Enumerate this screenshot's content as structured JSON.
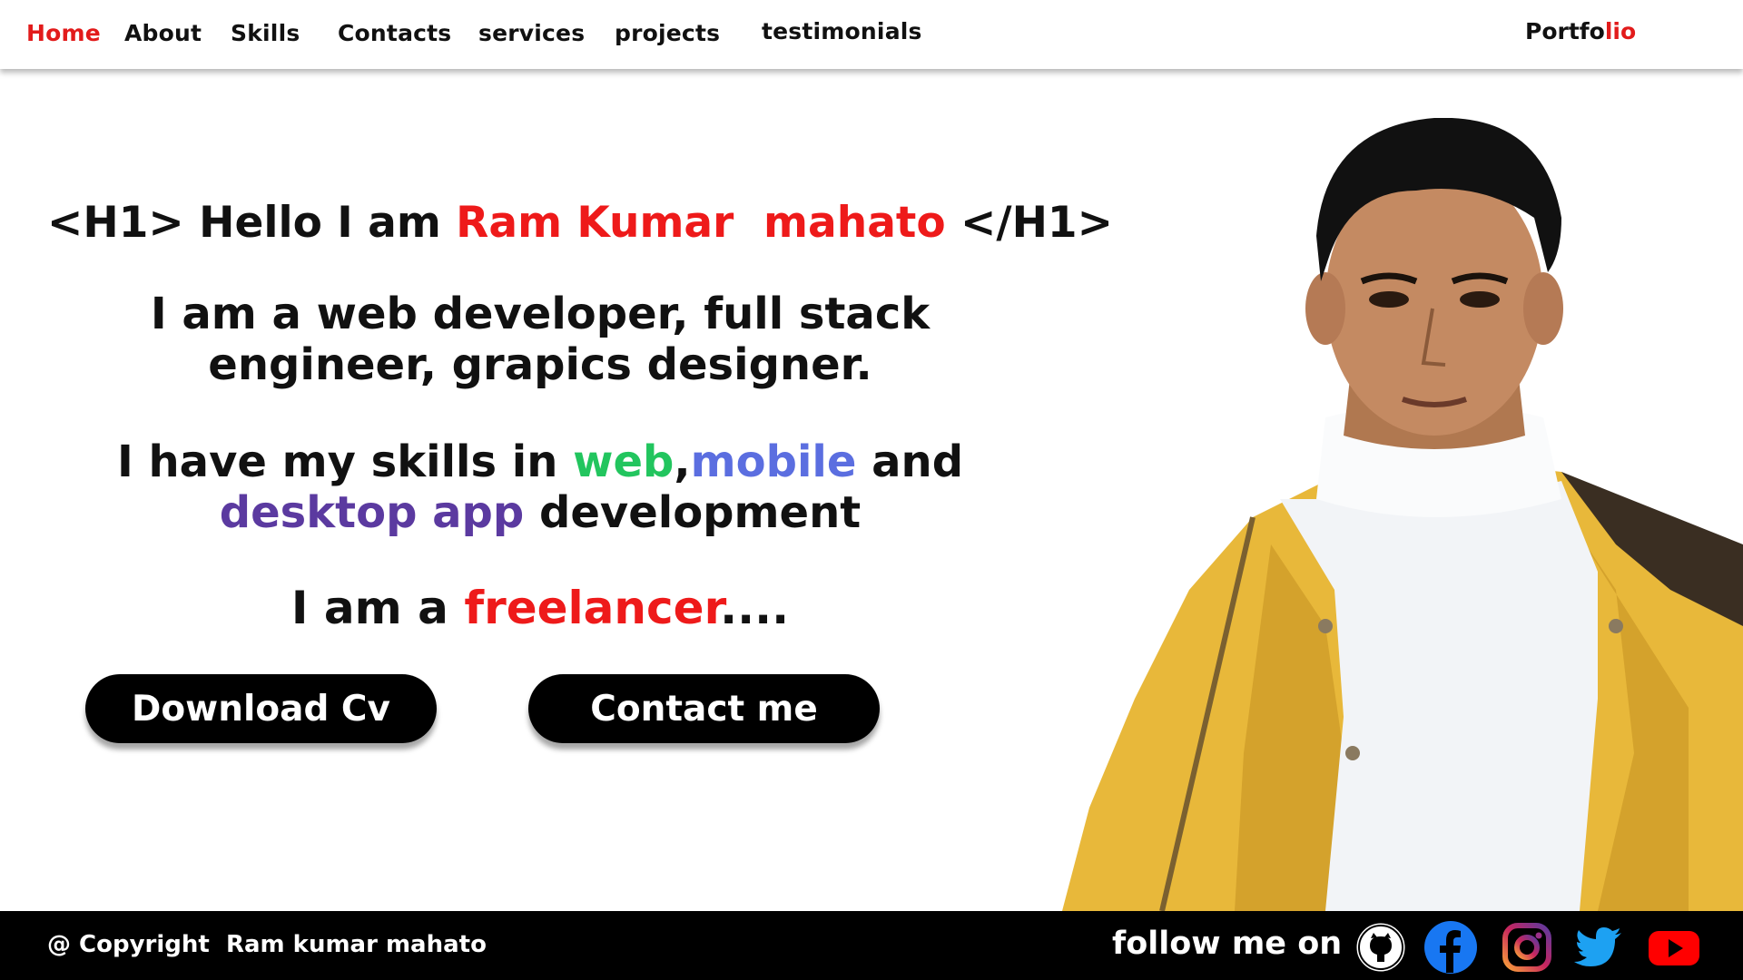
{
  "nav": {
    "items": [
      {
        "label": "Home",
        "active": true
      },
      {
        "label": "About"
      },
      {
        "label": "Skills"
      },
      {
        "label": "Contacts"
      },
      {
        "label": "services"
      },
      {
        "label": "projects"
      },
      {
        "label": "testimonials"
      }
    ],
    "brand_prefix": "Portfo",
    "brand_accent": "lio"
  },
  "hero": {
    "h1_open": "<H1> Hello I am ",
    "name": "Ram Kumar  mahato",
    "h1_close": " </H1>",
    "intro_line1": "I am a web developer, full stack",
    "intro_line2": "engineer, grapics designer.",
    "skills_prefix": "I have my skills in ",
    "skill_web": "web",
    "skill_sep": ",",
    "skill_mobile": "mobile",
    "skill_and": " and",
    "skill_desktop": "desktop app",
    "skill_suffix": " development",
    "freelance_prefix": "I am a ",
    "freelance_word": "freelancer",
    "freelance_suffix": "....",
    "download_cv": "Download Cv",
    "contact_me": "Contact me"
  },
  "footer": {
    "copyright": "@ Copyright  Ram kumar mahato",
    "follow": "follow me on :",
    "socials": [
      "github-icon",
      "facebook-icon",
      "instagram-icon",
      "twitter-icon",
      "youtube-icon"
    ]
  },
  "colors": {
    "accent_red": "#e21b1b",
    "web_green": "#22c55e",
    "mobile_blue": "#5b6ee0",
    "desktop_purple": "#5b3aa0",
    "facebook": "#1877f2",
    "twitter": "#1da1f2",
    "youtube": "#ff0000"
  }
}
